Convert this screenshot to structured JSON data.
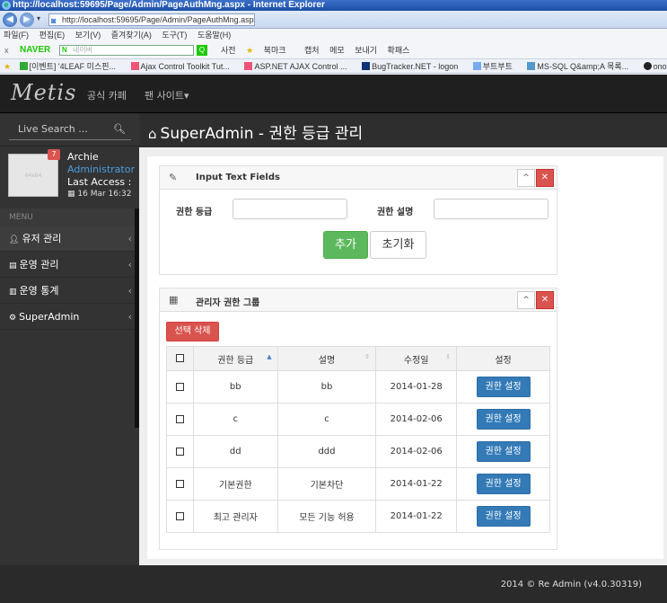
{
  "browser": {
    "title": "http://localhost:59695/Page/Admin/PageAuthMng.aspx - Internet Explorer",
    "address": "http://localhost:59695/Page/Admin/PageAuthMng.aspx",
    "menu": [
      "파일(F)",
      "편집(E)",
      "보기(V)",
      "즐겨찾기(A)",
      "도구(T)",
      "도움말(H)"
    ],
    "naver_label": "NAVER",
    "naver_placeholder": "네이버",
    "toolbar_items": [
      "사전",
      "북마크",
      "캡처",
      "메모",
      "보내기",
      "확패스"
    ],
    "favorites": [
      "[이벤트] '4LEAF 미스핀...",
      "Ajax Control Toolkit Tut...",
      "ASP.NET AJAX Control ...",
      "BugTracker.NET - logon",
      "부트부트",
      "MS-SQL Q&amp;A 목록...",
      "onokumus-Bootstrap"
    ]
  },
  "app": {
    "brand": "Metis",
    "nav_links": [
      "공식 카페",
      "팬 사이트▾"
    ]
  },
  "sidebar": {
    "search_label": "Live Search ...",
    "user": {
      "badge": "7",
      "avatar_text": "64x64",
      "name": "Archie",
      "role": "Administrator",
      "access": "Last Access :",
      "date": "16 Mar 16:32"
    },
    "menu_header": "MENU",
    "items": [
      {
        "label": "유저 관리",
        "icon": "user-icon"
      },
      {
        "label": "운영 관리",
        "icon": "file-icon"
      },
      {
        "label": "운영 통계",
        "icon": "chart-icon"
      },
      {
        "label": "SuperAdmin",
        "icon": "gear-icon"
      }
    ]
  },
  "page": {
    "title": "SuperAdmin - 권한 등급 관리"
  },
  "form_box": {
    "title": "Input Text Fields",
    "field1_label": "권한 등급",
    "field2_label": "권한 설명",
    "field1_value": "",
    "field2_value": "",
    "add_label": "추가",
    "reset_label": "초기화"
  },
  "grid_box": {
    "title": "관리자 권한 그룹",
    "delete_label": "선택 삭제",
    "columns": [
      "권한 등급",
      "설명",
      "수정일",
      "설정"
    ],
    "rows": [
      {
        "grade": "bb",
        "desc": "bb",
        "date": "2014-01-28",
        "action": "권한 설정"
      },
      {
        "grade": "c",
        "desc": "c",
        "date": "2014-02-06",
        "action": "권한 설정"
      },
      {
        "grade": "dd",
        "desc": "ddd",
        "date": "2014-02-06",
        "action": "권한 설정"
      },
      {
        "grade": "기본권한",
        "desc": "기본차단",
        "date": "2014-01-22",
        "action": "권한 설정"
      },
      {
        "grade": "최고 관리자",
        "desc": "모든 기능 허용",
        "date": "2014-01-22",
        "action": "권한 설정"
      }
    ]
  },
  "footer": {
    "text": "2014 © Re Admin (v4.0.30319)"
  },
  "colors": {
    "accent_green": "#5cb85c",
    "accent_blue": "#337ab7",
    "danger_red": "#d9534f",
    "sidebar_bg": "#333333",
    "header_bg": "#1f1f1f"
  }
}
